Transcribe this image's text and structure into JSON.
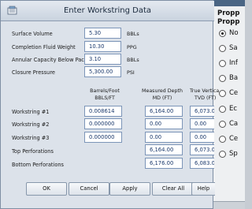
{
  "dialog": {
    "title": "Enter Workstring Data",
    "buttons": {
      "ok": "OK",
      "cancel": "Cancel",
      "apply": "Apply",
      "clear_all": "Clear All",
      "help": "Help"
    }
  },
  "fluid_properties": [
    {
      "label": "Surface Volume",
      "value": "5.30",
      "unit": "BBLs"
    },
    {
      "label": "Completion Fluid Weight",
      "value": "10.30",
      "unit": "PPG"
    },
    {
      "label": "Annular Capacity Below Packer",
      "value": "3.10",
      "unit": "BBLs"
    },
    {
      "label": "Closure Pressure",
      "value": "5,300.00",
      "unit": "PSI"
    }
  ],
  "columns": {
    "capacity": [
      "Barrels/Foot",
      "BBLS/FT"
    ],
    "measured_depth": [
      "Measured Depth",
      "MD (FT)"
    ],
    "true_vertical": [
      "True Vertica",
      "TVD (FT)"
    ]
  },
  "workstrings": [
    {
      "label": "Workstring #1",
      "capacity": "0.008614",
      "md": "6,164.00",
      "tvd": "6,073.0"
    },
    {
      "label": "Workstring #2",
      "capacity": "0.000000",
      "md": "0.00",
      "tvd": "0.00"
    },
    {
      "label": "Workstring #3",
      "capacity": "0.000000",
      "md": "0.00",
      "tvd": "0.00"
    }
  ],
  "perforations": [
    {
      "label": "Top Perforations",
      "md": "6,164.00",
      "tvd": "6,073.0"
    },
    {
      "label": "Bottom Perforations",
      "md": "6,176.00",
      "tvd": "6,083.0"
    }
  ],
  "background_window": {
    "header_lines": [
      "Propp",
      "Propp"
    ],
    "options": [
      {
        "label": "No",
        "selected": true
      },
      {
        "label": "Sa",
        "selected": false
      },
      {
        "label": "Inf",
        "selected": false
      },
      {
        "label": "Ba",
        "selected": false
      },
      {
        "label": "Ce",
        "selected": false
      },
      {
        "label": "Ec",
        "selected": false
      },
      {
        "label": "Ca",
        "selected": false
      },
      {
        "label": "Ce",
        "selected": false
      },
      {
        "label": "Sp",
        "selected": false
      }
    ]
  }
}
